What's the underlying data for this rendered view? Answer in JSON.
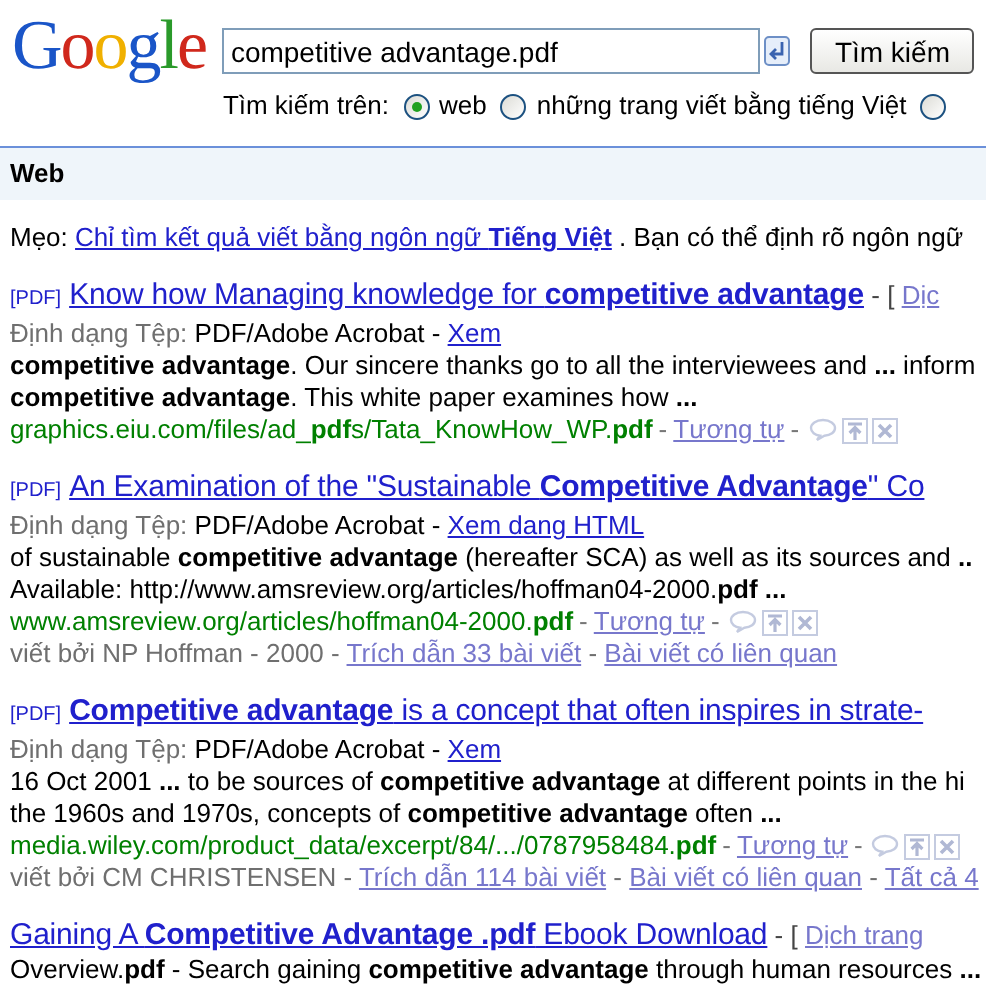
{
  "logo": "Google",
  "separator": "-",
  "search": {
    "value": "competitive advantage.pdf",
    "button": "Tìm kiếm"
  },
  "scope": {
    "label": "Tìm kiếm trên:",
    "options": [
      {
        "label": "web",
        "selected": true
      },
      {
        "label": "những trang viết bằng tiếng Việt",
        "selected": false
      },
      {
        "selected": false
      }
    ]
  },
  "section_bar": {
    "title": "Web"
  },
  "tip": {
    "label": "Mẹo:",
    "link": "Chỉ tìm kết quả viết bằng ngôn ngữ **Tiếng Việt**",
    "text": ". Bạn có thể định rõ ngôn ngữ"
  },
  "results": [
    {
      "tag": "[PDF]",
      "title": "Know how Managing knowledge for **competitive advantage**",
      "title_suffix": "[",
      "translate": "Dịc",
      "format_label": "Định dạng Tệp:",
      "format": "PDF/Adobe Acrobat",
      "view_link": "Xem",
      "snippet": [
        "**competitive advantage**. Our sincere thanks go to all the interviewees and **...** inform",
        "**competitive advantage**. This white paper examines how **...**"
      ],
      "url": "graphics.eiu.com/files/ad_**pdf**s/Tata_KnowHow_WP.**pdf**",
      "similar": "Tương tự"
    },
    {
      "tag": "[PDF]",
      "title": "An Examination of the \"Sustainable **Competitive Advantage**\" Co",
      "format_label": "Định dạng Tệp:",
      "format": "PDF/Adobe Acrobat",
      "view_link": "Xem dang HTML",
      "snippet": [
        "of sustainable **competitive advantage** (hereafter SCA) as well as its sources and **..**",
        "Available: http://www.amsreview.org/articles/hoffman04-2000.**pdf ...**"
      ],
      "url": "www.amsreview.org/articles/hoffman04-2000.**pdf**",
      "similar": "Tương tự",
      "author": "viết bởi NP Hoffman - 2000",
      "author_links": [
        "Trích dẫn 33 bài viết",
        "Bài viết có liên quan"
      ]
    },
    {
      "tag": "[PDF]",
      "title": "**Competitive advantage** is a concept that often inspires in strate-",
      "format_label": "Định dạng Tệp:",
      "format": "PDF/Adobe Acrobat",
      "view_link": "Xem",
      "snippet": [
        "16 Oct 2001 **...** to be sources of **competitive advantage** at different points in the hi",
        "the 1960s and 1970s, concepts of **competitive advantage** often **...**"
      ],
      "url": "media.wiley.com/product_data/excerpt/84/.../0787958484.**pdf**",
      "similar": "Tương tự",
      "author": "viết bởi CM CHRISTENSEN",
      "author_links": [
        "Trích dẫn 114 bài viết",
        "Bài viết có liên quan",
        "Tất cả 4"
      ]
    },
    {
      "title": "Gaining A **Competitive Advantage .pdf** Ebook Download",
      "title_suffix": "[",
      "translate": "Dịch trang",
      "snippet": [
        "Overview.**pdf** - Search gaining **competitive advantage** through human resources **...**"
      ]
    }
  ]
}
